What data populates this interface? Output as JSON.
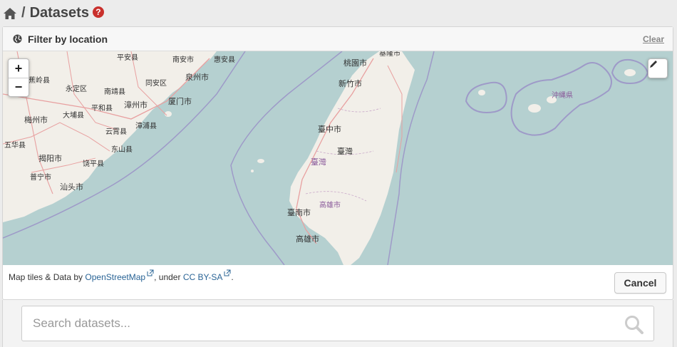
{
  "breadcrumb": {
    "separator": "/",
    "title": "Datasets",
    "help_symbol": "?"
  },
  "filter_panel": {
    "title": "Filter by location",
    "clear_label": "Clear"
  },
  "map": {
    "zoom_in_label": "+",
    "zoom_out_label": "−",
    "labels": [
      {
        "text": "平安县",
        "id": "l1"
      },
      {
        "text": "南安市",
        "id": "l2"
      },
      {
        "text": "惠安县",
        "id": "l3"
      },
      {
        "text": "泉州市",
        "id": "l4"
      },
      {
        "text": "蕉岭县",
        "id": "l5"
      },
      {
        "text": "永定区",
        "id": "l6"
      },
      {
        "text": "南靖县",
        "id": "l7"
      },
      {
        "text": "同安区",
        "id": "l8"
      },
      {
        "text": "平和县",
        "id": "l9"
      },
      {
        "text": "漳州市",
        "id": "l10"
      },
      {
        "text": "厦门市",
        "id": "l11"
      },
      {
        "text": "梅州市",
        "id": "l12"
      },
      {
        "text": "大埔县",
        "id": "l13"
      },
      {
        "text": "漳浦县",
        "id": "l14"
      },
      {
        "text": "云霄县",
        "id": "l15"
      },
      {
        "text": "五华县",
        "id": "l16"
      },
      {
        "text": "东山县",
        "id": "l17"
      },
      {
        "text": "揭阳市",
        "id": "l18"
      },
      {
        "text": "饶平县",
        "id": "l19"
      },
      {
        "text": "普宁市",
        "id": "l20"
      },
      {
        "text": "汕头市",
        "id": "l21"
      },
      {
        "text": "桃園市",
        "id": "l22"
      },
      {
        "text": "新竹市",
        "id": "l23"
      },
      {
        "text": "臺中市",
        "id": "l24"
      },
      {
        "text": "臺灣",
        "id": "l25"
      },
      {
        "text": "臺灣",
        "id": "l26"
      },
      {
        "text": "高雄市",
        "id": "l27"
      },
      {
        "text": "臺南市",
        "id": "l28"
      },
      {
        "text": "高雄市",
        "id": "l29"
      },
      {
        "text": "沖縄県",
        "id": "l30"
      },
      {
        "text": "基隆市",
        "id": "l31"
      }
    ]
  },
  "attribution": {
    "prefix": "Map tiles & Data by ",
    "osm_link": "OpenStreetMap",
    "middle": ", under ",
    "license_link": "CC BY-SA",
    "suffix": "."
  },
  "cancel_label": "Cancel",
  "search": {
    "placeholder": "Search datasets..."
  },
  "colors": {
    "sea": "#b5d0d0",
    "land": "#f2efe9",
    "border": "#9e9ac8",
    "road": "#e8a0a0"
  }
}
